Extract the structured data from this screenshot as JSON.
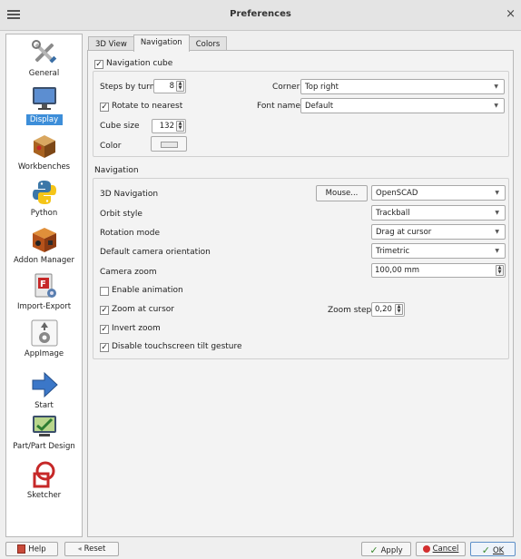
{
  "window": {
    "title": "Preferences",
    "close_glyph": "×"
  },
  "sidebar": {
    "items": [
      {
        "label": "General",
        "icon": "wrench-screwdriver-icon"
      },
      {
        "label": "Display",
        "icon": "monitor-icon",
        "selected": true
      },
      {
        "label": "Workbenches",
        "icon": "workbench-cube-icon"
      },
      {
        "label": "Python",
        "icon": "python-logo-icon"
      },
      {
        "label": "Addon Manager",
        "icon": "addon-box-icon"
      },
      {
        "label": "Import-Export",
        "icon": "import-export-icon"
      },
      {
        "label": "AppImage",
        "icon": "appimage-gear-icon"
      },
      {
        "label": "Start",
        "icon": "start-arrow-icon"
      },
      {
        "label": "Part/Part Design",
        "icon": "part-design-icon"
      },
      {
        "label": "Sketcher",
        "icon": "sketcher-icon"
      }
    ]
  },
  "tabs": [
    {
      "label": "3D View"
    },
    {
      "label": "Navigation",
      "active": true
    },
    {
      "label": "Colors"
    }
  ],
  "nav_cube": {
    "enabled_label": "Navigation cube",
    "enabled": true,
    "steps_label": "Steps by turn",
    "steps_value": "8",
    "rotate_label": "Rotate to nearest",
    "rotate_checked": true,
    "cube_size_label": "Cube size",
    "cube_size_value": "132",
    "color_label": "Color",
    "corner_label": "Corner",
    "corner_value": "Top right",
    "font_label": "Font name:",
    "font_value": "Default"
  },
  "navigation": {
    "group_title": "Navigation",
    "nav3d_label": "3D Navigation",
    "mouse_button": "Mouse...",
    "nav3d_value": "OpenSCAD",
    "orbit_label": "Orbit style",
    "orbit_value": "Trackball",
    "rotation_label": "Rotation mode",
    "rotation_value": "Drag at cursor",
    "orientation_label": "Default camera orientation",
    "orientation_value": "Trimetric",
    "zoom_label": "Camera zoom",
    "zoom_value": "100,00 mm",
    "animation_label": "Enable animation",
    "animation_checked": false,
    "zoom_cursor_label": "Zoom at cursor",
    "zoom_cursor_checked": true,
    "zoom_step_label": "Zoom step",
    "zoom_step_value": "0,20",
    "invert_label": "Invert zoom",
    "invert_checked": true,
    "tilt_label": "Disable touchscreen tilt gesture",
    "tilt_checked": true
  },
  "bottom": {
    "help_label": "Help",
    "reset_label": "Reset",
    "apply_label": "Apply",
    "cancel_label": "Cancel",
    "ok_label": "OK"
  },
  "glyphs": {
    "check": "✓",
    "dropdown": "▼",
    "up": "▲",
    "down": "▼"
  },
  "colors": {
    "selection": "#3d8ed9",
    "cube_color": "#e8e8e8"
  }
}
